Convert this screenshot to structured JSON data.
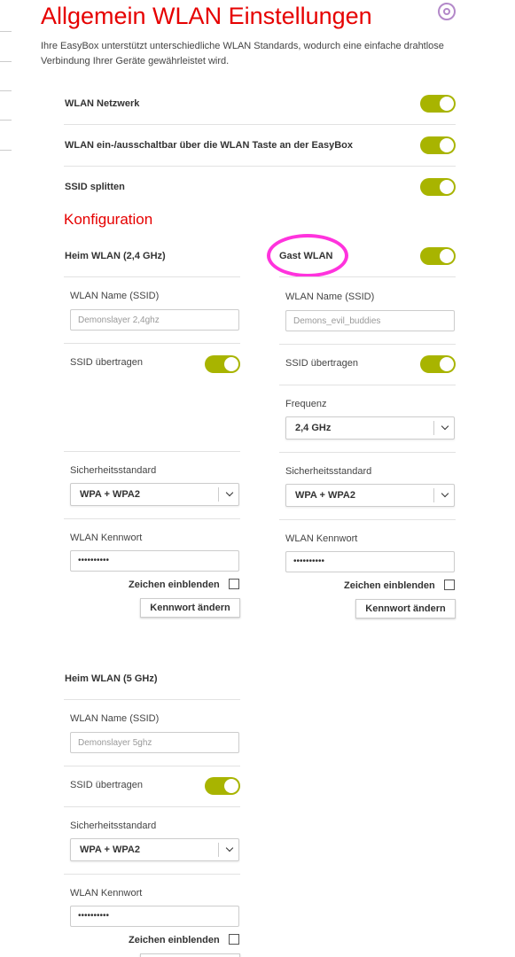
{
  "page": {
    "title": "Allgemein WLAN Einstellungen",
    "subtitle": "Ihre EasyBox unterstützt unterschiedliche WLAN Standards, wodurch eine einfache drahtlose Verbindung Ihrer Geräte gewährleistet wird.",
    "help_icon": "help-circle-icon"
  },
  "general": {
    "wlan_network": {
      "label": "WLAN Netzwerk",
      "enabled": true
    },
    "wlan_button": {
      "label": "WLAN ein-/ausschaltbar über die WLAN Taste an der EasyBox",
      "enabled": true
    },
    "ssid_split": {
      "label": "SSID splitten",
      "enabled": true
    }
  },
  "config": {
    "heading": "Konfiguration",
    "home_24": {
      "title": "Heim WLAN (2,4 GHz)",
      "ssid_label": "WLAN Name (SSID)",
      "ssid_placeholder": "Demonslayer 2,4ghz",
      "broadcast_label": "SSID übertragen",
      "broadcast_enabled": true,
      "security_label": "Sicherheitsstandard",
      "security_value": "WPA + WPA2",
      "password_label": "WLAN Kennwort",
      "password_value": "••••••••••",
      "show_chars_label": "Zeichen einblenden",
      "change_password_label": "Kennwort ändern"
    },
    "guest": {
      "title": "Gast WLAN",
      "enabled": true,
      "ssid_label": "WLAN Name (SSID)",
      "ssid_placeholder": "Demons_evil_buddies",
      "broadcast_label": "SSID übertragen",
      "broadcast_enabled": true,
      "frequency_label": "Frequenz",
      "frequency_value": "2,4 GHz",
      "security_label": "Sicherheitsstandard",
      "security_value": "WPA + WPA2",
      "password_label": "WLAN Kennwort",
      "password_value": "••••••••••",
      "show_chars_label": "Zeichen einblenden",
      "change_password_label": "Kennwort ändern"
    },
    "home_5": {
      "title": "Heim WLAN (5 GHz)",
      "ssid_label": "WLAN Name (SSID)",
      "ssid_placeholder": "Demonslayer 5ghz",
      "broadcast_label": "SSID übertragen",
      "broadcast_enabled": true,
      "security_label": "Sicherheitsstandard",
      "security_value": "WPA + WPA2",
      "password_label": "WLAN Kennwort",
      "password_value": "••••••••••",
      "show_chars_label": "Zeichen einblenden"
    }
  },
  "colors": {
    "accent": "#e60000",
    "toggle_on": "#a8b400",
    "annotation": "#ff33dd"
  }
}
